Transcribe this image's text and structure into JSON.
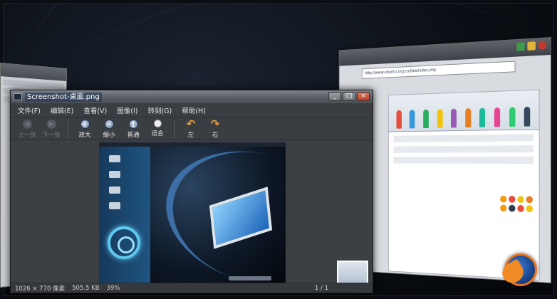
{
  "viewer": {
    "title": "Screenshot-桌面.png",
    "menu": [
      "文件(F)",
      "编辑(E)",
      "查看(V)",
      "图像(I)",
      "转到(G)",
      "帮助(H)"
    ],
    "toolbar": {
      "prev": "上一张",
      "next": "下一张",
      "zoom_in": "放大",
      "zoom_out": "缩小",
      "normal": "普通",
      "fit": "适合",
      "rotate_left": "左",
      "rotate_right": "右"
    },
    "status": {
      "dimensions": "1026 × 770 像素",
      "size": "505.5 KB",
      "zoom": "39%",
      "position": "1 / 1"
    },
    "window_buttons": {
      "minimize": "_",
      "maximize": "□",
      "close": "×"
    }
  },
  "browser": {
    "url": "http://www.ubuntu.org.cn/bbs/index.php"
  },
  "colors": {
    "desktop_bg": "#0b0f15",
    "viewer_bg": "#3c3f44",
    "accent_blue": "#5ec8ef",
    "firefox_orange": "#e8731d"
  }
}
